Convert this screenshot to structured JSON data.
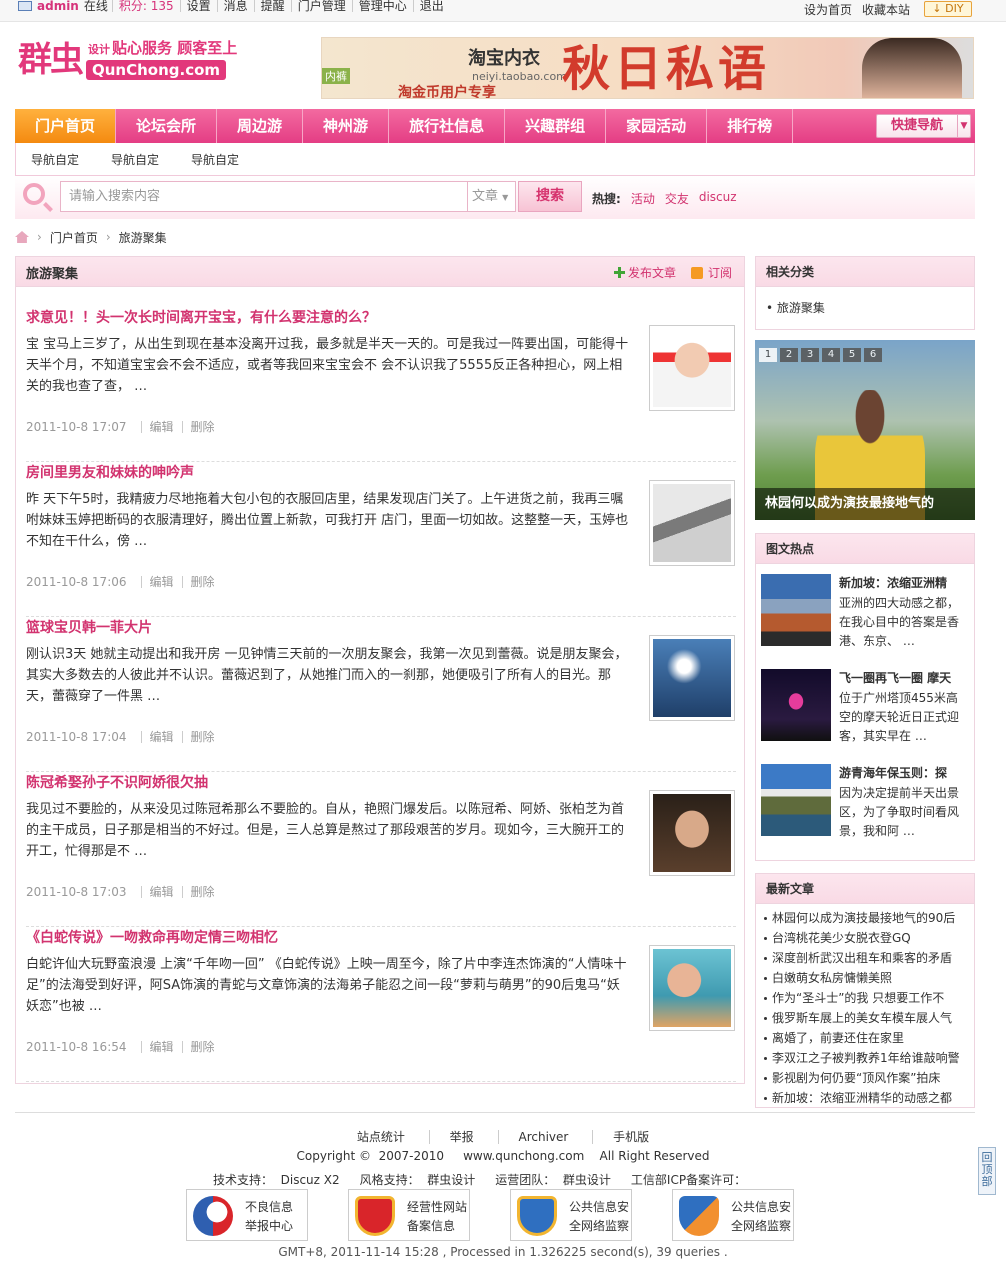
{
  "topbar": {
    "username": "admin",
    "status": "在线",
    "points": "积分: 135",
    "links": [
      "设置",
      "消息",
      "提醒",
      "门户管理",
      "管理中心",
      "退出"
    ],
    "right_links": [
      "设为首页",
      "收藏本站"
    ],
    "diy": "DIY"
  },
  "logo": {
    "brand": "群虫",
    "design": "设计",
    "slogan": "贴心服务 顾客至上",
    "url": "QunChong.com"
  },
  "banner": {
    "shop": "淘宝内衣",
    "shop_url": "neiyi.taobao.com",
    "headline": "秋日私语",
    "promo": "淘金币用户专享",
    "tag": "内裤"
  },
  "nav": {
    "items": [
      "门户首页",
      "论坛会所",
      "周边游",
      "神州游",
      "旅行社信息",
      "兴趣群组",
      "家园活动",
      "排行榜"
    ],
    "quick": "快捷导航"
  },
  "subnav": [
    "导航自定",
    "导航自定",
    "导航自定"
  ],
  "search": {
    "placeholder": "请输入搜索内容",
    "type": "文章",
    "button": "搜索",
    "hot_label": "热搜:",
    "hot": [
      "活动",
      "交友",
      "discuz"
    ]
  },
  "breadcrumb": [
    "门户首页",
    "旅游聚集"
  ],
  "main": {
    "title": "旅游聚集",
    "publish": "发布文章",
    "subscribe": "订阅",
    "edit": "编辑",
    "delete": "删除",
    "articles": [
      {
        "title": "求意见！！头一次长时间离开宝宝，有什么要注意的么？",
        "summary": "宝 宝马上三岁了，从出生到现在基本没离开过我，最多就是半天一天的。可是我过一阵要出国，可能得十天半个月，不知道宝宝会不会不适应，或者等我回来宝宝会不 会不认识我了5555反正各种担心，网上相关的我也查了查， …",
        "date": "2011-10-8 17:07"
      },
      {
        "title": "房间里男友和妹妹的呻吟声",
        "summary": "昨 天下午5时，我精疲力尽地拖着大包小包的衣服回店里，结果发现店门关了。上午进货之前，我再三嘱咐妹妹玉婷把断码的衣服清理好，腾出位置上新款，可我打开 店门，里面一切如故。这整整一天，玉婷也不知在干什么，傍 …",
        "date": "2011-10-8 17:06"
      },
      {
        "title": "篮球宝贝韩一菲大片",
        "summary": "刚认识3天 她就主动提出和我开房 一见钟情三天前的一次朋友聚会，我第一次见到蕾薇。说是朋友聚会，其实大多数去的人彼此并不认识。蕾薇迟到了，从她推门而入的一刹那，她便吸引了所有人的目光。那天，蕾薇穿了一件黑 …",
        "date": "2011-10-8 17:04"
      },
      {
        "title": "陈冠希娶孙子不识阿娇很欠抽",
        "summary": "我见过不要脸的，从来没见过陈冠希那么不要脸的。自从，艳照门爆发后。以陈冠希、阿娇、张柏芝为首的主干成员，日子那是相当的不好过。但是，三人总算是熬过了那段艰苦的岁月。现如今，三大腕开工的开工，忙得那是不 …",
        "date": "2011-10-8 17:03"
      },
      {
        "title": "《白蛇传说》一吻救命再吻定情三吻相忆",
        "summary": "白蛇许仙大玩野蛮浪漫 上演“千年吻一回” 《白蛇传说》上映一周至今，除了片中李连杰饰演的“人情味十足”的法海受到好评，阿SA饰演的青蛇与文章饰演的法海弟子能忍之间一段“萝莉与萌男”的90后鬼马“妖妖恋”也被 …",
        "date": "2011-10-8 16:54"
      }
    ]
  },
  "sidebar": {
    "related_title": "相关分类",
    "related_item": "旅游聚集",
    "slider_nums": [
      "1",
      "2",
      "3",
      "4",
      "5",
      "6"
    ],
    "slider_caption": "林园何以成为演技最接地气的",
    "pic_title": "图文热点",
    "pics": [
      {
        "title": "新加坡：浓缩亚洲精",
        "desc": "亚洲的四大动感之都，在我心目中的答案是香港、东京、 …"
      },
      {
        "title": "飞一圈再飞一圈 摩天",
        "desc": "位于广州塔顶455米高空的摩天轮近日正式迎客，其实早在 …"
      },
      {
        "title": "游青海年保玉则：探",
        "desc": "因为决定提前半天出景区，为了争取时间看风景，我和阿 …"
      }
    ],
    "new_title": "最新文章",
    "new_items": [
      "林园何以成为演技最接地气的90后",
      "台湾桃花美少女脱衣登GQ",
      "深度剖析武汉出租车和乘客的矛盾",
      "白嫩萌女私房慵懒美照",
      "作为“圣斗士”的我 只想要工作不",
      "俄罗斯车展上的美女车模车展人气",
      "离婚了，前妻还住在家里",
      "李双江之子被判教养1年给谁敲响警",
      "影视剧为何仍要“顶风作案”拍床",
      "新加坡：浓缩亚洲精华的动感之都"
    ]
  },
  "footer": {
    "links": [
      "站点统计",
      "举报",
      "Archiver",
      "手机版"
    ],
    "copyright": "Copyright ©  2007-2010     www.qunchong.com    All Right Reserved",
    "support": [
      "技术支持：  Discuz X2",
      "风格支持：  群虫设计",
      "运营团队：  群虫设计",
      "工信部ICP备案许可："
    ],
    "badges": [
      {
        "l1": "不良信息",
        "l2": "举报中心"
      },
      {
        "l1": "经营性网站",
        "l2": "备案信息"
      },
      {
        "l1": "公共信息安",
        "l2": "全网络监察"
      },
      {
        "l1": "公共信息安",
        "l2": "全网络监察"
      }
    ],
    "gmt": "GMT+8, 2011-11-14 15:28 , Processed in 1.326225 second(s), 39 queries .",
    "totop": "回顶部"
  },
  "colors": {
    "accent": "#e43d84",
    "nav_active": "#f48a10",
    "link": "#d2336f"
  }
}
